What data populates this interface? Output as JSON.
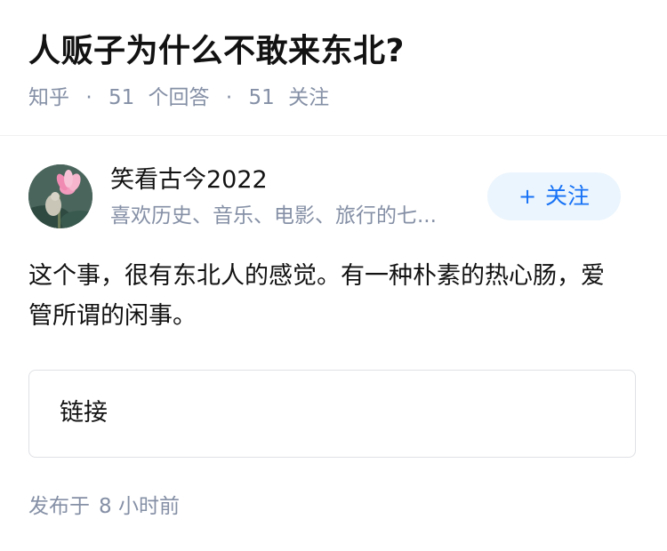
{
  "question": {
    "title": "人贩子为什么不敢来东北?",
    "source": "知乎",
    "answer_count": "51",
    "answer_label": "个回答",
    "follow_count": "51",
    "follow_label": "关注",
    "separator": "·"
  },
  "answer": {
    "author": {
      "name": "笑看古今2022",
      "bio": "喜欢历史、音乐、电影、旅行的七...",
      "avatar_icon": "avatar-lotus-image"
    },
    "follow_button": {
      "icon": "+",
      "label": "关注"
    },
    "content": "这个事，很有东北人的感觉。有一种朴素的热心肠，爱管所谓的闲事。",
    "link_card": {
      "label": "链接"
    },
    "published_prefix": "发布于",
    "published_time": "8 小时前"
  },
  "colors": {
    "accent": "#1772f6",
    "follow_bg": "#ebf5fd",
    "meta_text": "#8590a6",
    "body_text": "#121212"
  }
}
